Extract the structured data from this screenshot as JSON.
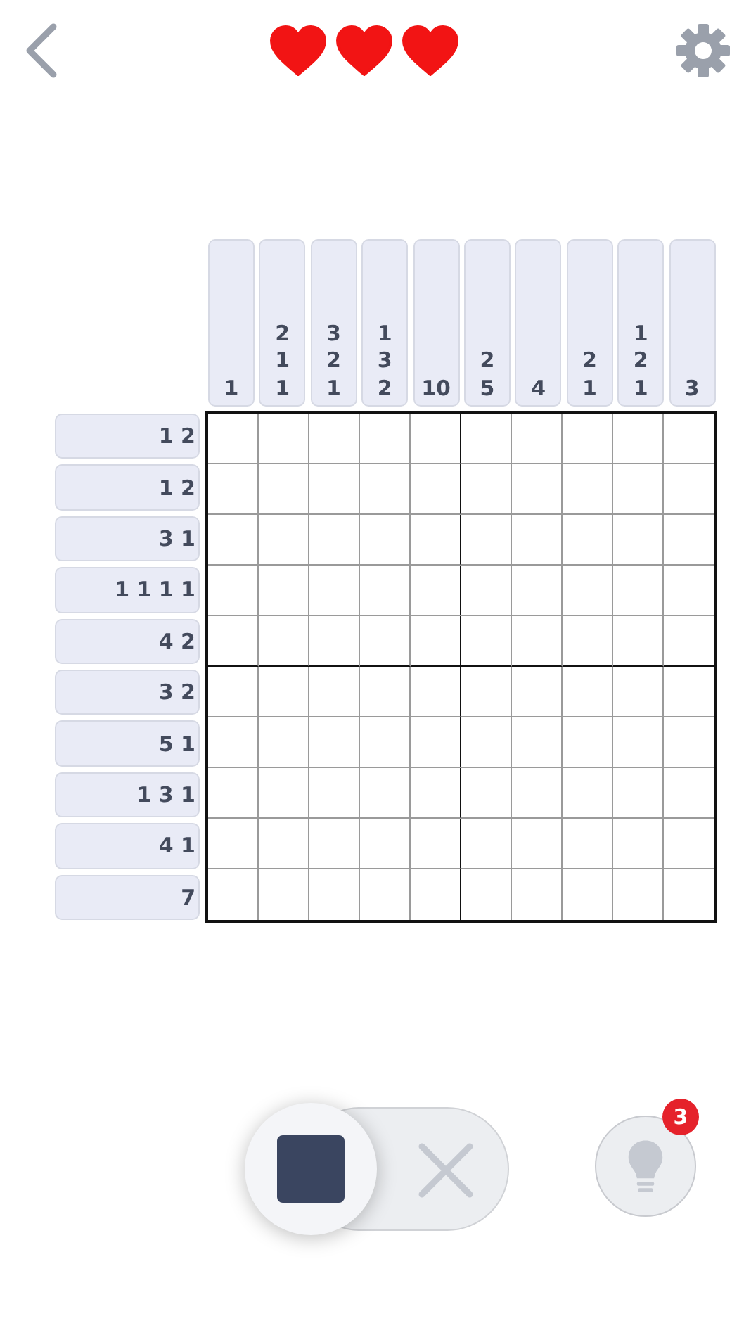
{
  "lives": [
    {
      "filled": true
    },
    {
      "filled": true
    },
    {
      "filled": true
    }
  ],
  "column_clues": [
    [
      "1"
    ],
    [
      "2",
      "1",
      "1"
    ],
    [
      "3",
      "2",
      "1"
    ],
    [
      "1",
      "3",
      "2"
    ],
    [
      "10"
    ],
    [
      "2",
      "5"
    ],
    [
      "4"
    ],
    [
      "2",
      "1"
    ],
    [
      "1",
      "2",
      "1"
    ],
    [
      "3"
    ]
  ],
  "row_clues": [
    "1 2",
    "1 2",
    "3 1",
    "1 1 1 1",
    "4 2",
    "3 2",
    "5 1",
    "1 3 1",
    "4 1",
    "7"
  ],
  "mode_toggle": [
    {
      "kind": "fill",
      "selected": true
    },
    {
      "kind": "cross",
      "selected": false
    }
  ],
  "hint": {
    "count": "3"
  }
}
